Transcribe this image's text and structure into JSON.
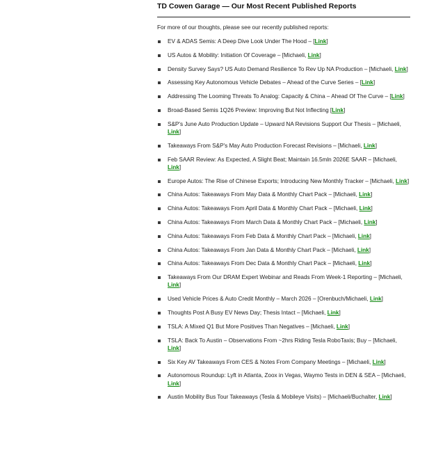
{
  "header": {
    "title": "TD Cowen Garage — Our Most Recent Published Reports",
    "intro": "For more of our thoughts, please see our recently published reports:"
  },
  "link_label": "Link",
  "colors": {
    "link": "#138a13"
  },
  "reports": [
    {
      "pre": "EV & ADAS Semis: A Deep Dive Look Under The Hood – [",
      "post": "]"
    },
    {
      "pre": "US Autos & Mobility: Initiation Of Coverage – [Michaeli, ",
      "post": "]"
    },
    {
      "pre": "Density Survey Says? US Auto Demand Resilience To Rev Up NA Production – [Michaeli, ",
      "post": "]"
    },
    {
      "pre": "Assessing Key Autonomous Vehicle Debates – Ahead of the Curve Series – [",
      "post": "]"
    },
    {
      "pre": "Addressing The Looming Threats To Analog: Capacity & China – Ahead Of The Curve – [",
      "post": "]"
    },
    {
      "pre": "Broad-Based Semis 1Q26 Preview: Improving But Not Inflecting [",
      "post": "]"
    },
    {
      "pre": "S&P's June Auto Production Update – Upward NA Revisions Support Our Thesis – [Michaeli, ",
      "post": "]"
    },
    {
      "pre": "Takeaways From S&P's May Auto Production Forecast Revisions – [Michaeli, ",
      "post": "]"
    },
    {
      "pre": "Feb SAAR Review: As Expected, A Slight Beat; Maintain 16.5mln 2026E SAAR – [Michaeli, ",
      "post": "]"
    },
    {
      "pre": "Europe Autos: The Rise of Chinese Exports; Introducing New Monthly Tracker – [Michaeli, ",
      "post": "]"
    },
    {
      "pre": "China Autos: Takeaways From May Data & Monthly Chart Pack – [Michaeli, ",
      "post": "]"
    },
    {
      "pre": "China Autos: Takeaways From April Data & Monthly Chart Pack – [Michaeli, ",
      "post": "]"
    },
    {
      "pre": "China Autos: Takeaways From March Data & Monthly Chart Pack – [Michaeli, ",
      "post": "]"
    },
    {
      "pre": "China Autos: Takeaways From Feb Data & Monthly Chart Pack – [Michaeli, ",
      "post": "]"
    },
    {
      "pre": "China Autos: Takeaways From Jan Data & Monthly Chart Pack – [Michaeli, ",
      "post": "]"
    },
    {
      "pre": "China Autos: Takeaways From Dec Data & Monthly Chart Pack – [Michaeli, ",
      "post": "]"
    },
    {
      "pre": "Takeaways From Our DRAM Expert Webinar and Reads From Week-1 Reporting – [Michaeli, ",
      "post": "]"
    },
    {
      "pre": "Used Vehicle Prices & Auto Credit Monthly – March 2026 – [Orenbuch/Michaeli, ",
      "post": "]"
    },
    {
      "pre": "Thoughts Post A Busy EV News Day; Thesis Intact – [Michaeli, ",
      "post": "]"
    },
    {
      "pre": "TSLA: A Mixed Q1 But More Positives Than Negatives – [Michaeli, ",
      "post": "]"
    },
    {
      "pre": "TSLA: Back To Austin – Observations From ~2hrs Riding Tesla RoboTaxis; Buy – [Michaeli, ",
      "post": "]"
    },
    {
      "pre": "Six Key AV Takeaways From CES & Notes From Company Meetings – [Michaeli, ",
      "post": "]"
    },
    {
      "pre": "Autonomous Roundup: Lyft in Atlanta, Zoox in Vegas, Waymo Tests in DEN & SEA – [Michaeli, ",
      "post": "]"
    },
    {
      "pre": "Austin Mobility Bus Tour Takeaways (Tesla & Mobileye Visits) – [Michaeli/Buchalter, ",
      "post": "]"
    }
  ]
}
